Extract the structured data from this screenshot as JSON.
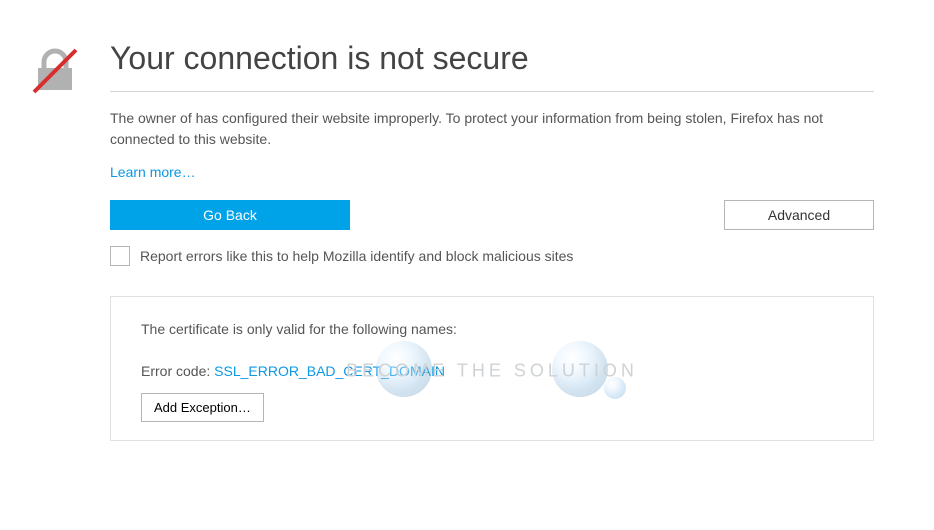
{
  "title": "Your connection is not secure",
  "description": "The owner of  has configured their website improperly. To protect your information from being stolen, Firefox has not connected to this website.",
  "learn_more": "Learn more…",
  "go_back": "Go Back",
  "advanced": "Advanced",
  "report_label": "Report errors like this to help Mozilla identify and block malicious sites",
  "cert_line": "The certificate is only valid for the following names:",
  "error_prefix": "Error code: ",
  "error_code": "SSL_ERROR_BAD_CERT_DOMAIN",
  "add_exception": "Add Exception…"
}
